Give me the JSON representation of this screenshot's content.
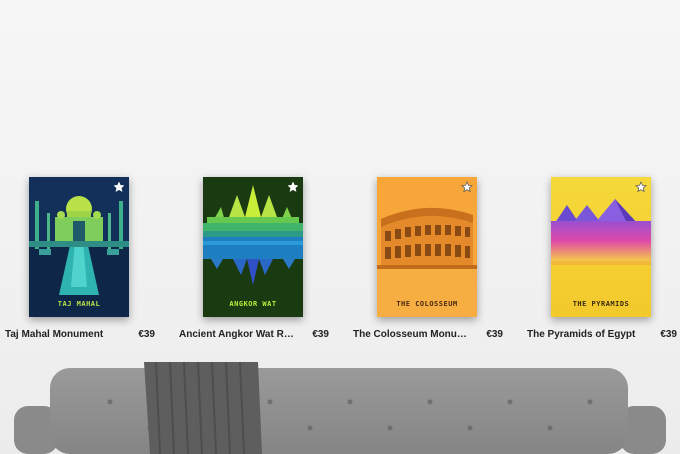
{
  "products": [
    {
      "name": "Taj Mahal Monument",
      "price": "€39",
      "poster_title": "TAJ MAHAL",
      "title_color": "#b7e04a"
    },
    {
      "name": "Ancient Angkor Wat Ruins",
      "price": "€39",
      "poster_title": "ANGKOR WAT",
      "title_color": "#b9f03c"
    },
    {
      "name": "The Colosseum Monument",
      "price": "€39",
      "poster_title": "THE COLOSSEUM",
      "title_color": "#4a2a10"
    },
    {
      "name": "The Pyramids of Egypt",
      "price": "€39",
      "poster_title": "THE PYRAMIDS",
      "title_color": "#3a2a10"
    }
  ],
  "icons": {
    "favorite": "star-icon"
  }
}
